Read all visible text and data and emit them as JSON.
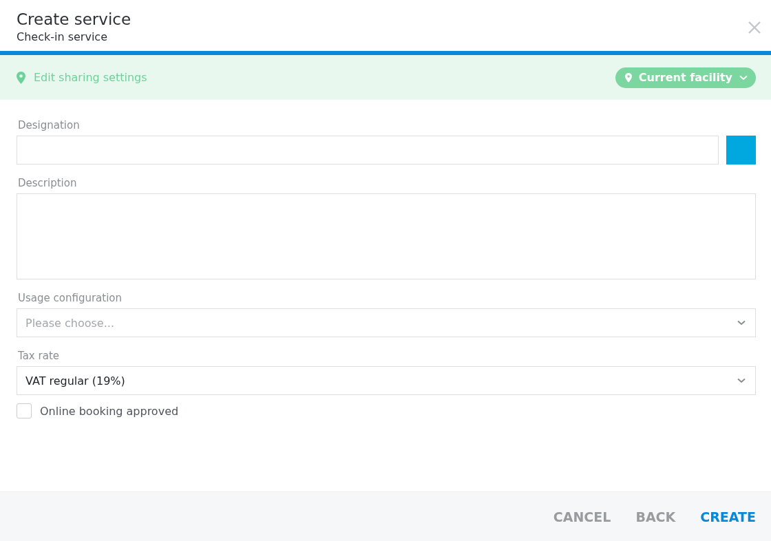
{
  "dialog": {
    "title": "Create service",
    "subtitle": "Check-in service"
  },
  "sharing": {
    "link": "Edit sharing settings",
    "scope": "Current facility"
  },
  "fields": [
    {
      "kind": "text",
      "label": "Designation",
      "color": "#00a8e0"
    },
    {
      "kind": "textarea",
      "label": "Description"
    },
    {
      "kind": "select",
      "label": "Usage configuration",
      "placeholder": "Please choose..."
    },
    {
      "kind": "select",
      "label": "Tax rate",
      "value": "VAT regular (19%)"
    },
    {
      "kind": "checkbox",
      "label": "Online booking approved",
      "checked": false
    }
  ],
  "buttons": [
    {
      "label": "CANCEL",
      "kind": "secondary"
    },
    {
      "label": "BACK",
      "kind": "secondary"
    },
    {
      "label": "CREATE",
      "kind": "primary"
    }
  ]
}
